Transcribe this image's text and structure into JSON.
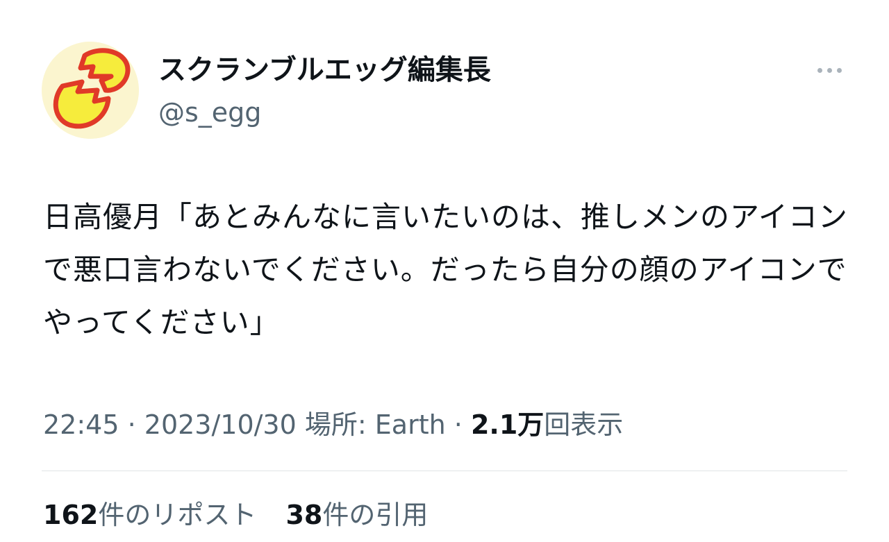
{
  "author": {
    "display_name": "スクランブルエッグ編集長",
    "handle": "@s_egg",
    "avatar_icon": "cracked-egg-logo"
  },
  "more_icon": "more-horizontal-icon",
  "tweet": {
    "text": "日高優月「あとみんなに言いたいのは、推しメンのアイコンで悪口言わないでください。だったら自分の顔のアイコンでやってください」"
  },
  "meta": {
    "time": "22:45",
    "separator": " · ",
    "date": "2023/10/30",
    "location_label": "場所: ",
    "location": "Earth",
    "views_count": "2.1万",
    "views_label": "回表示"
  },
  "stats": {
    "reposts_count": "162",
    "reposts_label": "件のリポスト",
    "quotes_count": "38",
    "quotes_label": "件の引用"
  },
  "colors": {
    "text_primary": "#0f1419",
    "text_secondary": "#536471",
    "divider": "#dfe3e6",
    "egg_yellow": "#f6ec3c",
    "egg_red": "#e03a28"
  }
}
